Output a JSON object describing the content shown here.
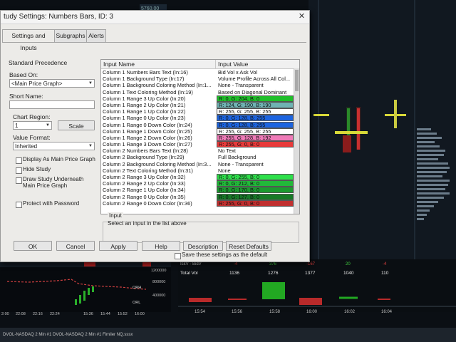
{
  "dialog": {
    "title": "tudy Settings: Numbers Bars, ID: 3",
    "close_glyph": "✕",
    "tabs": [
      {
        "label": "Settings and Inputs",
        "active": true
      },
      {
        "label": "Subgraphs",
        "active": false
      },
      {
        "label": "Alerts",
        "active": false
      }
    ],
    "left_panel": {
      "standard_precedence": "Standard Precedence",
      "based_on_label": "Based On:",
      "based_on_value": "<Main Price Graph>",
      "short_name_label": "Short Name:",
      "short_name_value": "",
      "chart_region_label": "Chart Region:",
      "chart_region_value": "1",
      "scale_button": "Scale",
      "value_format_label": "Value Format:",
      "value_format_value": "Inherited",
      "checkboxes": [
        "Display As Main Price Graph",
        "Hide Study",
        "Draw Study Underneath Main Price Graph",
        "Protect with Password"
      ]
    },
    "table": {
      "col_name": "Input Name",
      "col_value": "Input Value",
      "rows": [
        {
          "name": "Column 1 Numbers Bars Text  (In:16)",
          "value": "Bid Vol x Ask Vol",
          "color": ""
        },
        {
          "name": "Column 1 Background Type  (In:17)",
          "value": "Volume Profile Across All Col...",
          "color": ""
        },
        {
          "name": "Column 1 Background Coloring Method  (In:1...",
          "value": "None - Transparent",
          "color": ""
        },
        {
          "name": "Column 1 Text Coloring Method  (In:19)",
          "value": "Based on Diagonal Dominant",
          "color": ""
        },
        {
          "name": "Column 1 Range 3 Up Color  (In:20)",
          "value": "R: 0, G: 204, B: 0",
          "color": "#1fbf2a"
        },
        {
          "name": "Column 1 Range 2 Up Color  (In:21)",
          "value": "R: 124, G: 190, B: 190",
          "color": "#6fb3b3"
        },
        {
          "name": "Column 1 Range 1 Up Color  (In:22)",
          "value": "R: 255, G: 255, B: 255",
          "color": "#ffffff"
        },
        {
          "name": "Column 1 Range 0 Up Color  (In:23)",
          "value": "R: 0, G: 128, B: 255",
          "color": "#1c64e0"
        },
        {
          "name": "Column 1 Range 0 Down Color  (In:24)",
          "value": "R: 0, G: 128, B: 255",
          "color": "#1c64e0"
        },
        {
          "name": "Column 1 Range 1 Down Color  (In:25)",
          "value": "R: 255, G: 255, B: 255",
          "color": "#ffffff"
        },
        {
          "name": "Column 1 Range 2 Down Color  (In:26)",
          "value": "R: 255, G: 128, B: 192",
          "color": "#f07ab8"
        },
        {
          "name": "Column 1 Range 3 Down Color  (In:27)",
          "value": "R: 255, G: 0, B: 0",
          "color": "#e83a3a"
        },
        {
          "name": "Column 2 Numbers Bars Text  (In:28)",
          "value": "No Text",
          "color": ""
        },
        {
          "name": "Column 2 Background Type  (In:29)",
          "value": "Full Background",
          "color": ""
        },
        {
          "name": "Column 2 Background Coloring Method  (In:3...",
          "value": "None - Transparent",
          "color": ""
        },
        {
          "name": "Column 2 Text Coloring Method  (In:31)",
          "value": "None",
          "color": ""
        },
        {
          "name": "Column 2 Range 3 Up Color  (In:32)",
          "value": "R: 0, G: 255, B: 0",
          "color": "#2de04a"
        },
        {
          "name": "Column 2 Range 2 Up Color  (In:33)",
          "value": "R: 0, G: 212, B: 0",
          "color": "#22b83a"
        },
        {
          "name": "Column 2 Range 1 Up Color  (In:34)",
          "value": "R: 0, G: 170, B: 0",
          "color": "#1c9a30"
        },
        {
          "name": "Column 2 Range 0 Up Color  (In:35)",
          "value": "R: 0, G: 127, B: 0",
          "color": "#177a27"
        },
        {
          "name": "Column 2 Range 0 Down Color  (In:36)",
          "value": "R: 255, G: 0, B: 0",
          "color": "#c03030"
        }
      ]
    },
    "input_group_label": "Input",
    "input_hint": "Select an input in the list above",
    "buttons": [
      "OK",
      "Cancel",
      "Apply",
      "Help",
      "Description",
      "Reset Defaults"
    ],
    "save_default_label": "Save these settings as the default"
  },
  "background": {
    "top_price": "5760.00",
    "bottom_left_tabs": "DVOL-NASDAQ  2 Min  #1   DVOL-NASDAQ  2 Min  #1   Fimiler NQ.sssx",
    "left_chart_times": [
      "2:00",
      "22:08",
      "22:16",
      "22:24",
      "15:36",
      "15:44",
      "15:52",
      "16:00"
    ],
    "left_chart_values": [
      "1200000",
      "800000",
      "400000"
    ],
    "left_chart_tags": [
      "ORH",
      "ORL"
    ],
    "right_chart_header": "IskV - BidV",
    "total_vol_label": "Total Vol",
    "right_row_top": [
      "-4",
      "376",
      "-167",
      "20",
      "-4"
    ],
    "total_vol_values": [
      "1136",
      "1276",
      "1377",
      "1040",
      "110"
    ],
    "right_chart_times": [
      "15:54",
      "15:56",
      "15:58",
      "16:00",
      "16:02",
      "16:04"
    ]
  }
}
